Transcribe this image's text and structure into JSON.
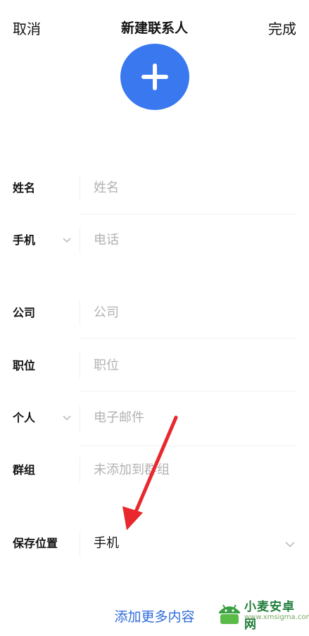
{
  "header": {
    "cancel": "取消",
    "title": "新建联系人",
    "done": "完成"
  },
  "avatar": {
    "icon": "plus-icon",
    "color": "#3a78f0"
  },
  "fields": {
    "name": {
      "label": "姓名",
      "placeholder": "姓名"
    },
    "phone": {
      "label": "手机",
      "placeholder": "电话"
    },
    "company": {
      "label": "公司",
      "placeholder": "公司"
    },
    "position": {
      "label": "职位",
      "placeholder": "职位"
    },
    "email": {
      "label": "个人",
      "placeholder": "电子邮件"
    },
    "group": {
      "label": "群组",
      "placeholder": "未添加到群组"
    },
    "storage": {
      "label": "保存位置",
      "value": "手机"
    }
  },
  "add_more": "添加更多内容",
  "watermark": {
    "name": "小麦安卓网",
    "url": "www.xmsigma.com"
  },
  "colors": {
    "accent": "#2f6bdc",
    "arrow": "#e8282c"
  }
}
